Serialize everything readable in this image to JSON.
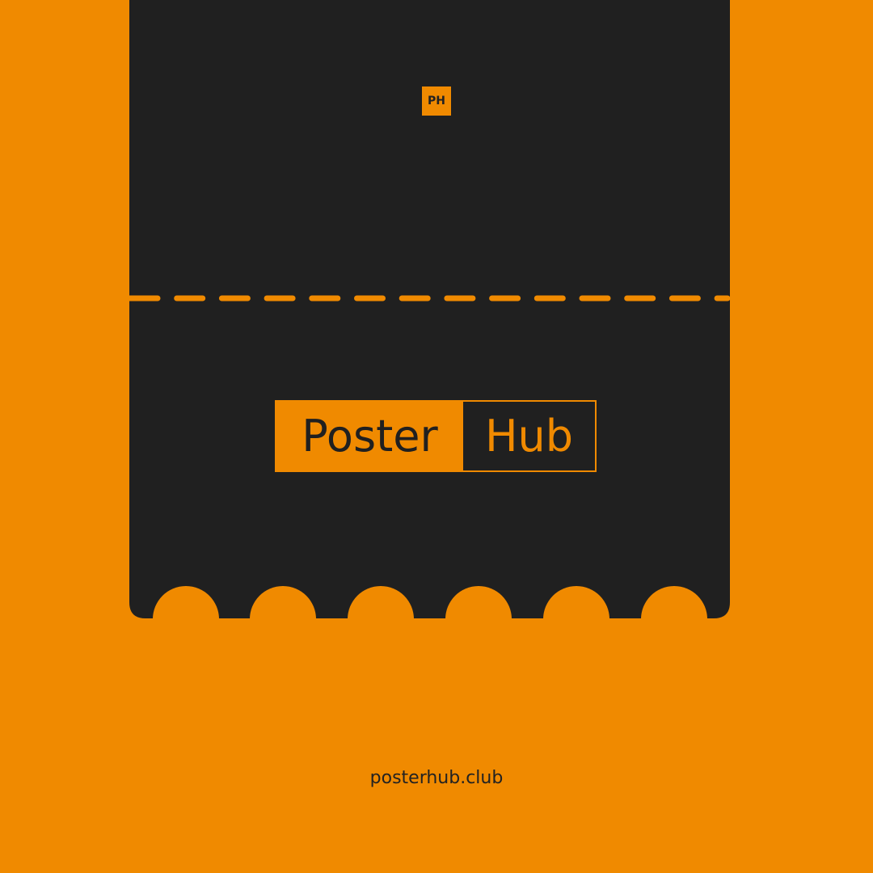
{
  "colors": {
    "background": "#f08a00",
    "ticket": "#202020",
    "accent": "#f08a00"
  },
  "badge": "PH",
  "logo": {
    "left": "Poster",
    "right": "Hub"
  },
  "url": "posterhub.club"
}
